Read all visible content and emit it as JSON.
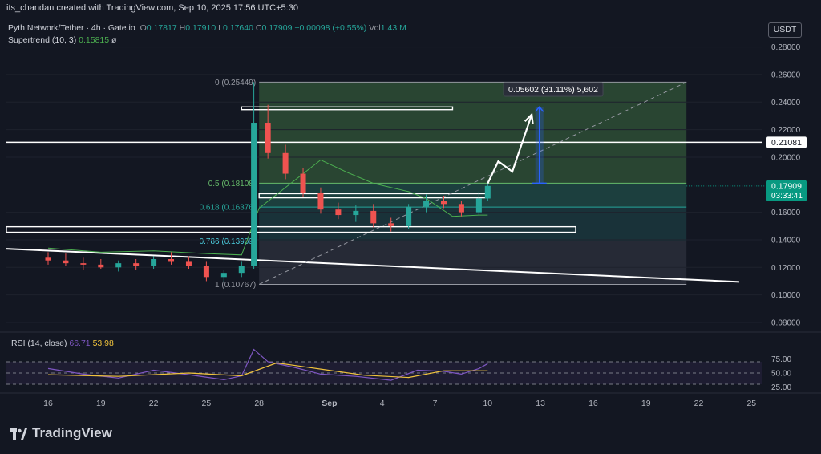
{
  "header": {
    "author_line": "its_chandan created with TradingView.com, Sep 10, 2025 17:56 UTC+5:30"
  },
  "legend": {
    "symbol": "Pyth Network/Tether · 4h · Gate.io",
    "o_label": "O",
    "o": "0.17817",
    "h_label": "H",
    "h": "0.17910",
    "l_label": "L",
    "l": "0.17640",
    "c_label": "C",
    "c": "0.17909",
    "change": "+0.00098 (+0.55%)",
    "vol_label": "Vol",
    "vol": "1.43 M",
    "supertrend_label": "Supertrend (10, 3)",
    "supertrend_value": "0.15815",
    "supertrend_extra": "ø"
  },
  "currency_button": "USDT",
  "rsi": {
    "label": "RSI (14, close)",
    "value1": "66.71",
    "value2": "53.98"
  },
  "brand": {
    "name": "TradingView"
  },
  "colors": {
    "background": "#131722",
    "up": "#26a69a",
    "down": "#ef5350",
    "fib_fill": "#2f4a36",
    "rsi_line": "#7e57c2",
    "rsi_ma": "#f0c33c"
  },
  "chart_data": {
    "type": "candlestick",
    "symbol": "Pyth Network/Tether",
    "timeframe": "4h",
    "y_axis": {
      "ticks": [
        "0.28000",
        "0.26000",
        "0.24000",
        "0.22000",
        "0.20000",
        "0.16000",
        "0.14000",
        "0.12000",
        "0.10000",
        "0.08000"
      ],
      "tick_values": [
        0.28,
        0.26,
        0.24,
        0.22,
        0.2,
        0.16,
        0.14,
        0.12,
        0.1,
        0.08
      ],
      "ylim": [
        0.073,
        0.285
      ]
    },
    "x_axis": {
      "ticks": [
        "16",
        "19",
        "22",
        "25",
        "28",
        "Sep",
        "4",
        "7",
        "10",
        "13",
        "16",
        "19",
        "22",
        "25"
      ],
      "tick_index": [
        -0.5,
        2.5,
        5.5,
        8.5,
        11.5,
        15.5,
        18.5,
        21.5,
        24.5,
        27.5,
        30.5,
        33.5,
        36.5,
        39.5
      ]
    },
    "price_labels": [
      {
        "value": 0.21081,
        "text": "0.21081"
      },
      {
        "value": 0.17909,
        "text": "0.17909",
        "sub": "03:33:41"
      }
    ],
    "fib_levels": [
      {
        "label": "0 (0.25449)",
        "value": 0.25449
      },
      {
        "label": "0.5 (0.18108)",
        "value": 0.18108
      },
      {
        "label": "0.618 (0.16376)",
        "value": 0.16376
      },
      {
        "label": "0.786 (0.13909)",
        "value": 0.13909
      },
      {
        "label": "1 (0.10767)",
        "value": 0.10767
      }
    ],
    "measure_label": "0.05602 (31.11%) 5,602",
    "horizontal_lines": [
      0.21081
    ],
    "rectangles": [
      {
        "x1": 10.5,
        "x2": 22.5,
        "y1": 0.2365,
        "y2": 0.2345
      },
      {
        "x1": 11.5,
        "x2": 24.5,
        "y1": 0.1735,
        "y2": 0.1705
      },
      {
        "x1": -18,
        "x2": 29.5,
        "y1": 0.1495,
        "y2": 0.1455
      }
    ],
    "trendline": [
      {
        "x": -18,
        "y": 0.1422
      },
      {
        "x": 38.8,
        "y": 0.1095
      }
    ],
    "projection_path": [
      {
        "x": 24.5,
        "y": 0.181
      },
      {
        "x": 25.1,
        "y": 0.197
      },
      {
        "x": 25.9,
        "y": 0.1895
      },
      {
        "x": 27.0,
        "y": 0.231
      }
    ],
    "candles_daily": [
      {
        "x": -0.5,
        "o": 0.127,
        "h": 0.131,
        "l": 0.122,
        "c": 0.125
      },
      {
        "x": 0.5,
        "o": 0.125,
        "h": 0.13,
        "l": 0.121,
        "c": 0.123
      },
      {
        "x": 1.5,
        "o": 0.123,
        "h": 0.127,
        "l": 0.118,
        "c": 0.122
      },
      {
        "x": 2.5,
        "o": 0.122,
        "h": 0.126,
        "l": 0.119,
        "c": 0.12
      },
      {
        "x": 3.5,
        "o": 0.12,
        "h": 0.125,
        "l": 0.117,
        "c": 0.123
      },
      {
        "x": 4.5,
        "o": 0.123,
        "h": 0.126,
        "l": 0.118,
        "c": 0.121
      },
      {
        "x": 5.5,
        "o": 0.121,
        "h": 0.128,
        "l": 0.119,
        "c": 0.126
      },
      {
        "x": 6.5,
        "o": 0.126,
        "h": 0.131,
        "l": 0.122,
        "c": 0.124
      },
      {
        "x": 7.5,
        "o": 0.124,
        "h": 0.128,
        "l": 0.119,
        "c": 0.121
      },
      {
        "x": 8.5,
        "o": 0.121,
        "h": 0.124,
        "l": 0.11,
        "c": 0.113
      },
      {
        "x": 9.5,
        "o": 0.113,
        "h": 0.118,
        "l": 0.109,
        "c": 0.116
      },
      {
        "x": 10.5,
        "o": 0.116,
        "h": 0.124,
        "l": 0.113,
        "c": 0.121
      },
      {
        "x": 11.2,
        "o": 0.121,
        "h": 0.2545,
        "l": 0.119,
        "c": 0.225
      },
      {
        "x": 12.0,
        "o": 0.225,
        "h": 0.238,
        "l": 0.199,
        "c": 0.203
      },
      {
        "x": 13.0,
        "o": 0.203,
        "h": 0.209,
        "l": 0.184,
        "c": 0.188
      },
      {
        "x": 14.0,
        "o": 0.188,
        "h": 0.192,
        "l": 0.171,
        "c": 0.174
      },
      {
        "x": 15.0,
        "o": 0.174,
        "h": 0.178,
        "l": 0.159,
        "c": 0.162
      },
      {
        "x": 16.0,
        "o": 0.162,
        "h": 0.167,
        "l": 0.155,
        "c": 0.158
      },
      {
        "x": 17.0,
        "o": 0.158,
        "h": 0.165,
        "l": 0.153,
        "c": 0.161
      },
      {
        "x": 18.0,
        "o": 0.161,
        "h": 0.166,
        "l": 0.149,
        "c": 0.152
      },
      {
        "x": 19.0,
        "o": 0.152,
        "h": 0.156,
        "l": 0.146,
        "c": 0.15
      },
      {
        "x": 20.0,
        "o": 0.15,
        "h": 0.166,
        "l": 0.148,
        "c": 0.164
      },
      {
        "x": 21.0,
        "o": 0.164,
        "h": 0.173,
        "l": 0.16,
        "c": 0.168
      },
      {
        "x": 22.0,
        "o": 0.168,
        "h": 0.172,
        "l": 0.163,
        "c": 0.166
      },
      {
        "x": 23.0,
        "o": 0.166,
        "h": 0.168,
        "l": 0.157,
        "c": 0.16
      },
      {
        "x": 24.0,
        "o": 0.16,
        "h": 0.175,
        "l": 0.158,
        "c": 0.17
      },
      {
        "x": 24.5,
        "o": 0.17,
        "h": 0.181,
        "l": 0.168,
        "c": 0.1791
      }
    ],
    "supertrend": [
      {
        "x": -0.5,
        "y": 0.134
      },
      {
        "x": 2.5,
        "y": 0.131
      },
      {
        "x": 5.5,
        "y": 0.132
      },
      {
        "x": 8.5,
        "y": 0.13
      },
      {
        "x": 10.5,
        "y": 0.129
      },
      {
        "x": 11.5,
        "y": 0.163
      },
      {
        "x": 15.0,
        "y": 0.198
      },
      {
        "x": 16.5,
        "y": 0.189
      },
      {
        "x": 18.0,
        "y": 0.181
      },
      {
        "x": 20.0,
        "y": 0.175
      },
      {
        "x": 21.0,
        "y": 0.17
      },
      {
        "x": 22.5,
        "y": 0.157
      },
      {
        "x": 24.0,
        "y": 0.158
      },
      {
        "x": 24.5,
        "y": 0.158
      }
    ],
    "rsi_series": [
      {
        "x": -0.5,
        "y": 58
      },
      {
        "x": 1.5,
        "y": 48
      },
      {
        "x": 3.5,
        "y": 41
      },
      {
        "x": 5.5,
        "y": 55
      },
      {
        "x": 7.5,
        "y": 47
      },
      {
        "x": 9.5,
        "y": 38
      },
      {
        "x": 10.5,
        "y": 45
      },
      {
        "x": 11.2,
        "y": 92
      },
      {
        "x": 12.0,
        "y": 70
      },
      {
        "x": 13.5,
        "y": 60
      },
      {
        "x": 15.0,
        "y": 48
      },
      {
        "x": 17.0,
        "y": 44
      },
      {
        "x": 19.0,
        "y": 37
      },
      {
        "x": 20.5,
        "y": 55
      },
      {
        "x": 22.0,
        "y": 53
      },
      {
        "x": 23.0,
        "y": 48
      },
      {
        "x": 24.0,
        "y": 58
      },
      {
        "x": 24.5,
        "y": 66.71
      }
    ],
    "rsi_ma_series": [
      {
        "x": -0.5,
        "y": 47
      },
      {
        "x": 3.5,
        "y": 44
      },
      {
        "x": 7.5,
        "y": 50
      },
      {
        "x": 10.5,
        "y": 45
      },
      {
        "x": 12.5,
        "y": 68
      },
      {
        "x": 15.0,
        "y": 57
      },
      {
        "x": 17.5,
        "y": 46
      },
      {
        "x": 20.0,
        "y": 42
      },
      {
        "x": 22.0,
        "y": 54
      },
      {
        "x": 24.5,
        "y": 53.98
      }
    ],
    "rsi_axis": {
      "ticks": [
        "75.00",
        "50.00",
        "25.00"
      ],
      "tick_values": [
        75,
        50,
        25
      ],
      "ylim": [
        20,
        100
      ]
    }
  }
}
